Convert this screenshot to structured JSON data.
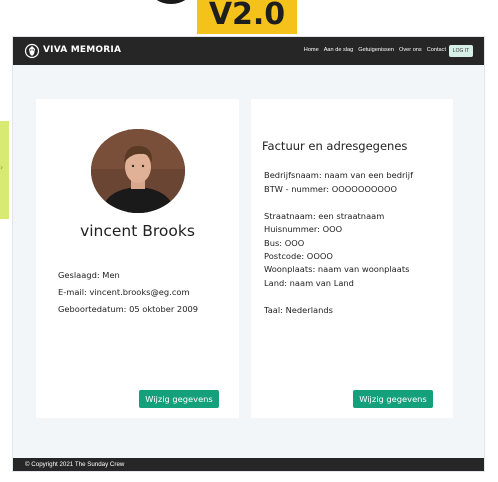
{
  "version_badge": "V2.0",
  "navbar": {
    "brand": "VIVA MEMORIA",
    "links": [
      "Home",
      "Aan de slag",
      "Getuigenissen",
      "Over ons",
      "Contact"
    ],
    "logout_label": "LOG IT"
  },
  "profile": {
    "name": "vincent Brooks",
    "gender": "Geslaagd: Men",
    "email": "E-mail: vincent.brooks@eg.com",
    "birthdate": "Geboortedatum: 05 oktober 2009",
    "edit_label": "Wijzig gegevens"
  },
  "billing": {
    "title": "Factuur en adresgegenes",
    "company": "Bedrijfsnaam: naam van een bedrijf",
    "vat": "BTW - nummer: OOOOOOOOOO",
    "street": "Straatnaam: een straatnaam",
    "house_number": "Huisnummer: OOO",
    "bus": "Bus: OOO",
    "postcode": "Postcode: OOOO",
    "city": "Woonplaats: naam van woonplaats",
    "country": "Land: naam van Land",
    "language": "Taal: Nederlands",
    "edit_label": "Wijzig gegevens"
  },
  "footer": {
    "copyright": "© Copyright 2021 The Sunday Crew"
  },
  "colors": {
    "navbar": "#262626",
    "accent": "#15a07c",
    "badge": "#f4c21a",
    "background": "#f3f6f9"
  }
}
